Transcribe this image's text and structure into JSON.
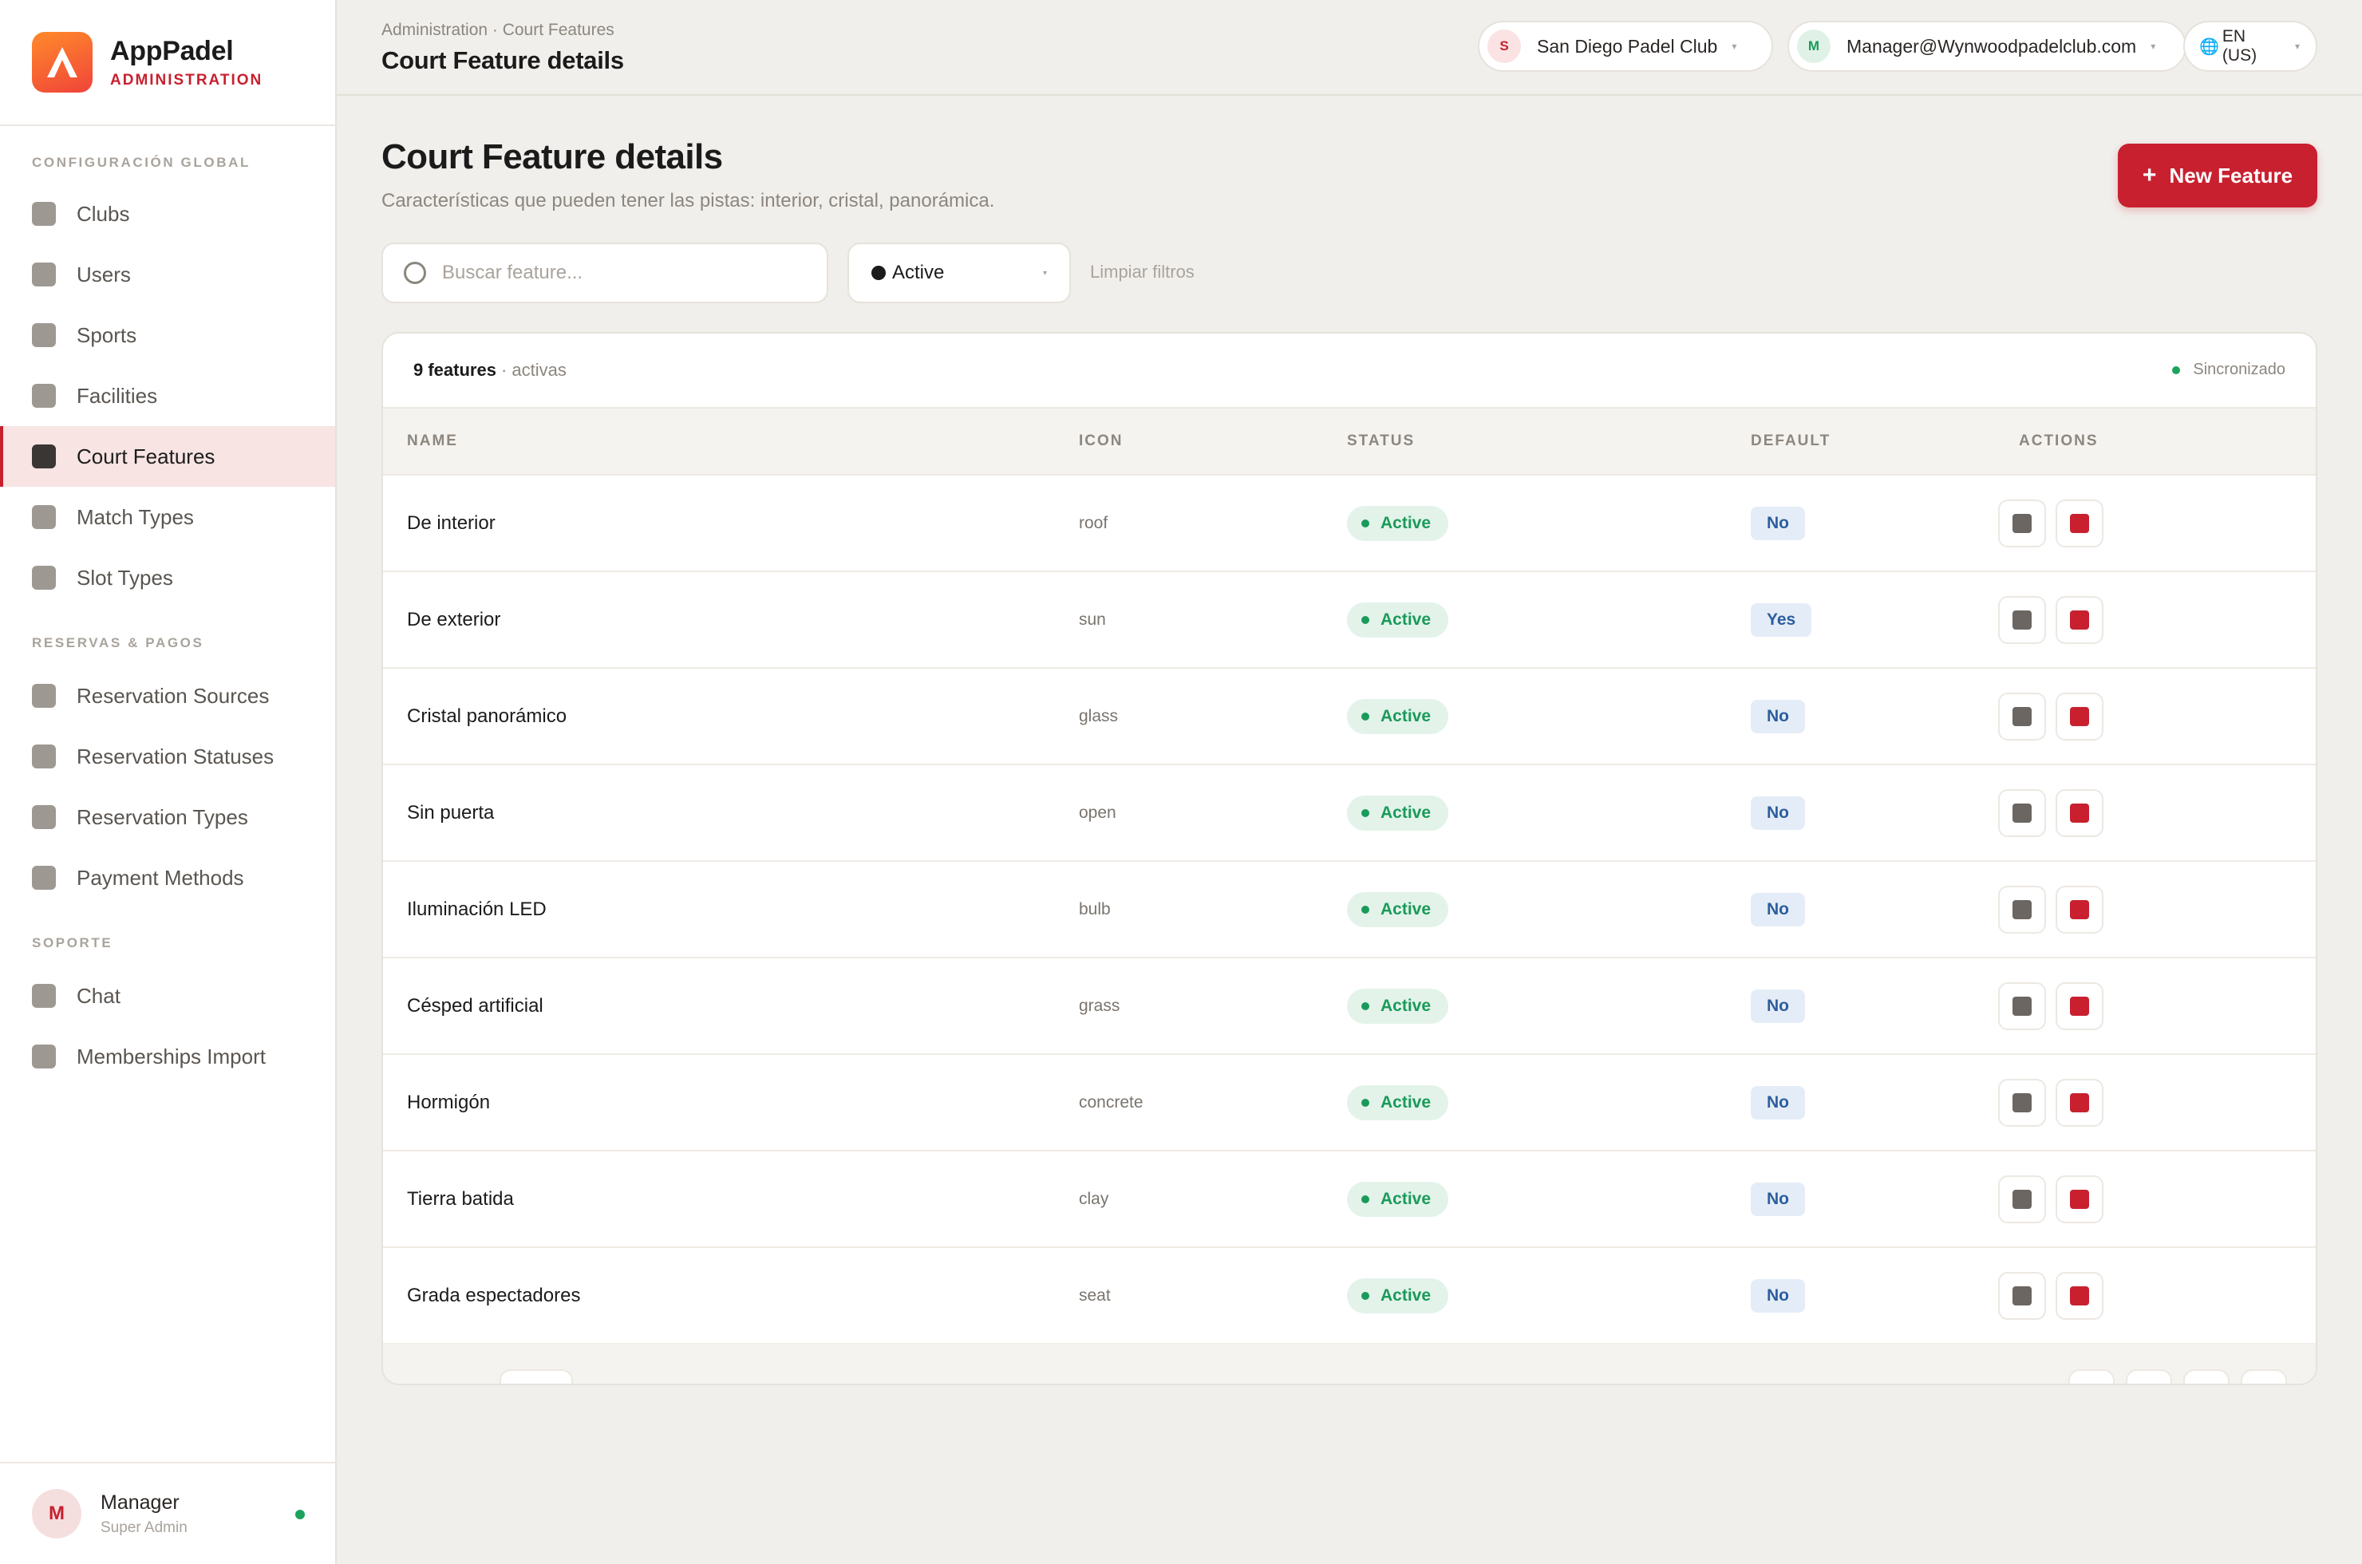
{
  "brand": {
    "name": "AppPadel",
    "subtitle": "ADMINISTRATION"
  },
  "sidebar": {
    "sections": [
      {
        "title": "CONFIGURACIÓN GLOBAL",
        "items": [
          "Clubs",
          "Users",
          "Sports",
          "Facilities",
          "Court Features",
          "Match Types",
          "Slot Types"
        ]
      },
      {
        "title": "RESERVAS & PAGOS",
        "items": [
          "Reservation Sources",
          "Reservation Statuses",
          "Reservation Types",
          "Payment Methods"
        ]
      },
      {
        "title": "SOPORTE",
        "items": [
          "Chat",
          "Memberships Import"
        ]
      }
    ],
    "active_item": "Court Features",
    "user": {
      "initial": "M",
      "name": "Manager",
      "role": "Super Admin",
      "status_color": "#1ea35c"
    }
  },
  "header": {
    "breadcrumb": "Administration · Court Features",
    "title": "Court Feature details",
    "club": {
      "initial": "S",
      "name": "San Diego Padel Club"
    },
    "account": {
      "initial": "M",
      "email": "Manager@Wynwoodpadelclub.com"
    },
    "language": {
      "label": "EN (US)"
    }
  },
  "main": {
    "title": "Court Feature details",
    "subtitle": "Características que pueden tener las pistas: interior, cristal, panorámica.",
    "new_button": "New Feature",
    "search": {
      "placeholder": "Buscar feature...",
      "value": ""
    },
    "status_filter": {
      "selected": "Active"
    },
    "clear_filters": "Limpiar filtros"
  },
  "table": {
    "count_label": "9 features",
    "count_suffix": "· activas",
    "sync_label": "Sincronizado",
    "columns": [
      "NAME",
      "ICON",
      "STATUS",
      "DEFAULT",
      "ACTIONS"
    ],
    "rows": [
      {
        "name": "De interior",
        "icon": "roof",
        "status": "Active",
        "default": "No"
      },
      {
        "name": "De exterior",
        "icon": "sun",
        "status": "Active",
        "default": "Yes"
      },
      {
        "name": "Cristal panorámico",
        "icon": "glass",
        "status": "Active",
        "default": "No"
      },
      {
        "name": "Sin puerta",
        "icon": "open",
        "status": "Active",
        "default": "No"
      },
      {
        "name": "Iluminación LED",
        "icon": "bulb",
        "status": "Active",
        "default": "No"
      },
      {
        "name": "Césped artificial",
        "icon": "grass",
        "status": "Active",
        "default": "No"
      },
      {
        "name": "Hormigón",
        "icon": "concrete",
        "status": "Active",
        "default": "No"
      },
      {
        "name": "Tierra batida",
        "icon": "clay",
        "status": "Active",
        "default": "No"
      },
      {
        "name": "Grada espectadores",
        "icon": "seat",
        "status": "Active",
        "default": "No"
      }
    ]
  },
  "colors": {
    "accent": "#c8202f",
    "success": "#1a9a5a",
    "info": "#2c5e9e"
  }
}
